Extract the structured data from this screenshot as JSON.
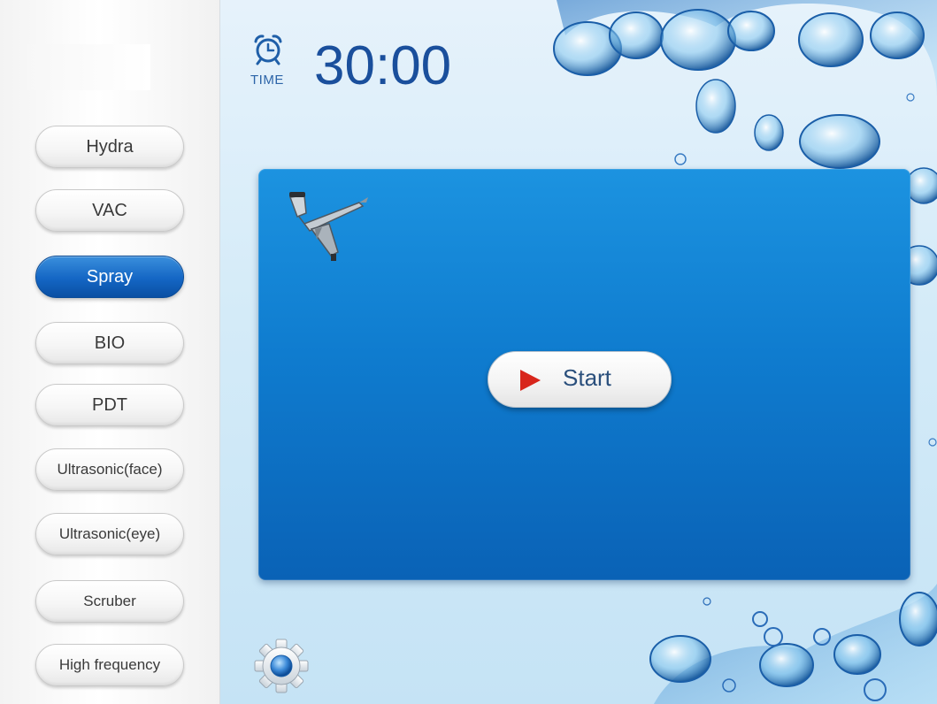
{
  "sidebar": {
    "items": [
      {
        "label": "Hydra",
        "active": false
      },
      {
        "label": "VAC",
        "active": false
      },
      {
        "label": "Spray",
        "active": true
      },
      {
        "label": "BIO",
        "active": false
      },
      {
        "label": "PDT",
        "active": false
      },
      {
        "label": "Ultrasonic(face)",
        "active": false
      },
      {
        "label": "Ultrasonic(eye)",
        "active": false
      },
      {
        "label": "Scruber",
        "active": false
      },
      {
        "label": "High frequency",
        "active": false
      }
    ]
  },
  "timer": {
    "icon": "alarm-clock-icon",
    "label": "TIME",
    "value": "30:00"
  },
  "panel": {
    "mode_icon": "spray-gun-icon",
    "start_label": "Start",
    "start_icon": "play-icon"
  },
  "footer": {
    "settings_icon": "gear-icon"
  },
  "colors": {
    "accent": "#1466c4",
    "panel_top": "#1c93e0",
    "panel_bottom": "#0a62b6",
    "timer_text": "#1a4f9c",
    "play": "#d8261c"
  }
}
